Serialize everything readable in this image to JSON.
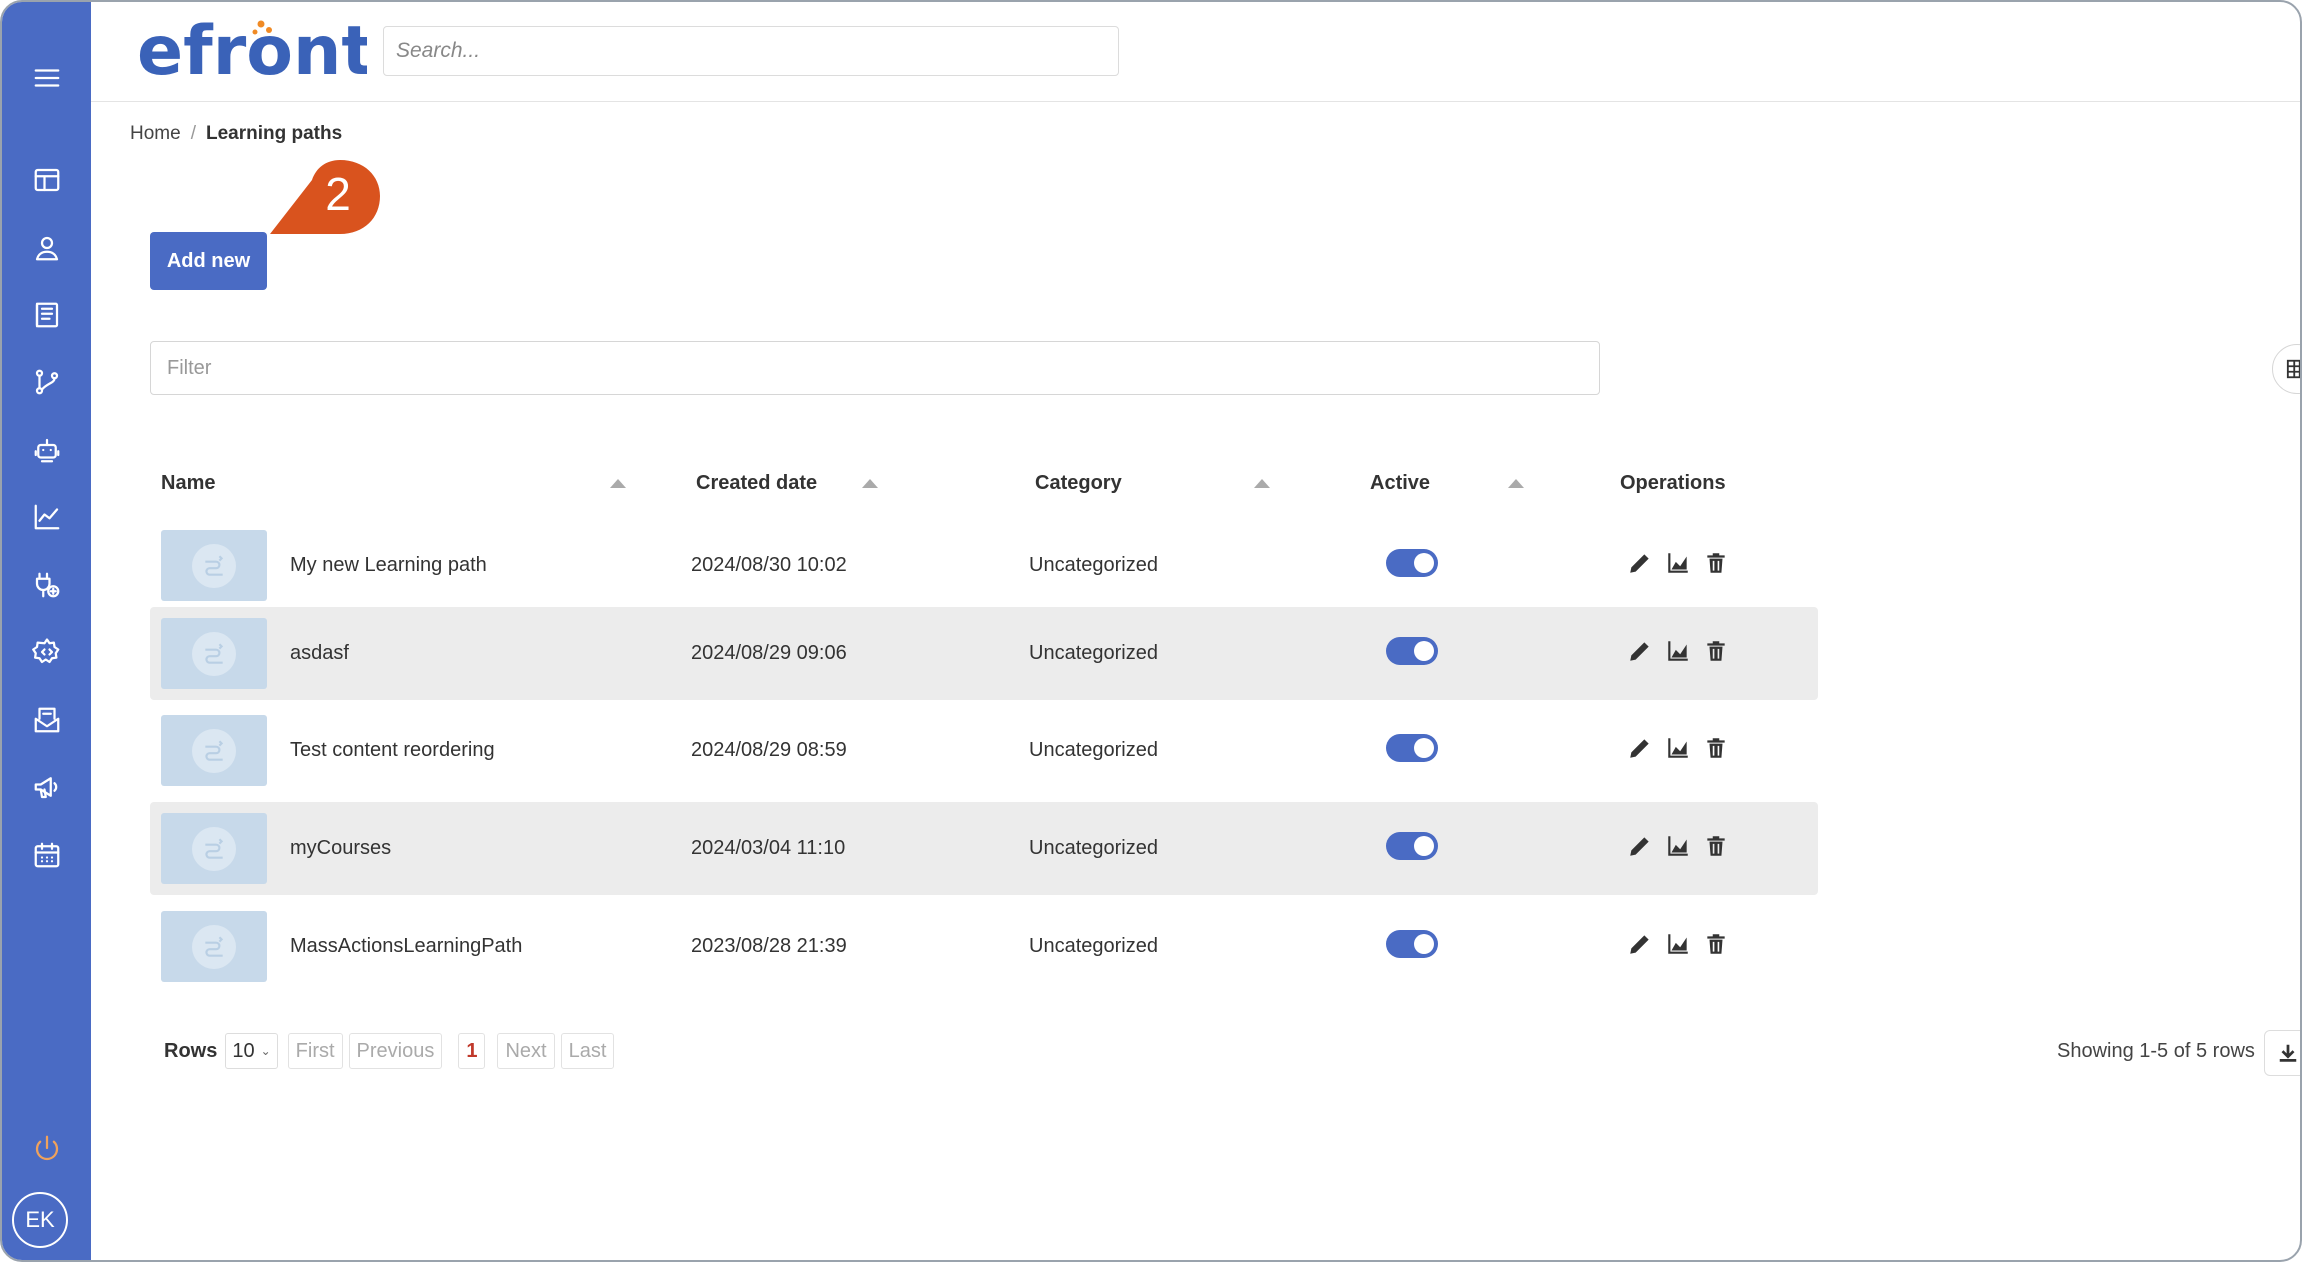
{
  "header": {
    "logo_text": "efront",
    "search_placeholder": "Search..."
  },
  "breadcrumb": {
    "home": "Home",
    "separator": "/",
    "current": "Learning paths"
  },
  "callout": {
    "number": "2",
    "color": "#d9531e"
  },
  "actions": {
    "add_new_label": "Add new"
  },
  "filter": {
    "placeholder": "Filter"
  },
  "sidebar": {
    "items": [
      {
        "icon": "menu-icon"
      },
      {
        "icon": "dashboard-icon"
      },
      {
        "icon": "user-icon"
      },
      {
        "icon": "book-icon"
      },
      {
        "icon": "branch-icon"
      },
      {
        "icon": "robot-icon"
      },
      {
        "icon": "chart-icon"
      },
      {
        "icon": "plugin-icon"
      },
      {
        "icon": "settings-code-icon"
      },
      {
        "icon": "inbox-icon"
      },
      {
        "icon": "megaphone-icon"
      },
      {
        "icon": "calendar-icon"
      },
      {
        "icon": "power-icon"
      }
    ],
    "avatar_initials": "EK"
  },
  "table": {
    "columns": [
      "Name",
      "Created date",
      "Category",
      "Active",
      "Operations"
    ],
    "rows": [
      {
        "name": "My new Learning path",
        "created": "2024/08/30 10:02",
        "category": "Uncategorized",
        "active": true
      },
      {
        "name": "asdasf",
        "created": "2024/08/29 09:06",
        "category": "Uncategorized",
        "active": true
      },
      {
        "name": "Test content reordering",
        "created": "2024/08/29 08:59",
        "category": "Uncategorized",
        "active": true
      },
      {
        "name": "myCourses",
        "created": "2024/03/04 11:10",
        "category": "Uncategorized",
        "active": true
      },
      {
        "name": "MassActionsLearningPath",
        "created": "2023/08/28 21:39",
        "category": "Uncategorized",
        "active": true
      }
    ],
    "operations": [
      "pencil-icon",
      "stats-icon",
      "trash-icon"
    ]
  },
  "pagination": {
    "rows_label": "Rows",
    "rows_value": "10",
    "first": "First",
    "previous": "Previous",
    "current_page": "1",
    "next": "Next",
    "last": "Last",
    "showing": "Showing 1-5 of 5 rows"
  },
  "colors": {
    "sidebar": "#4a6bc4",
    "primary": "#4a6bc4",
    "logo_blue": "#3a62b8",
    "logo_orange": "#f08a24",
    "accent_orange": "#d9531e"
  }
}
